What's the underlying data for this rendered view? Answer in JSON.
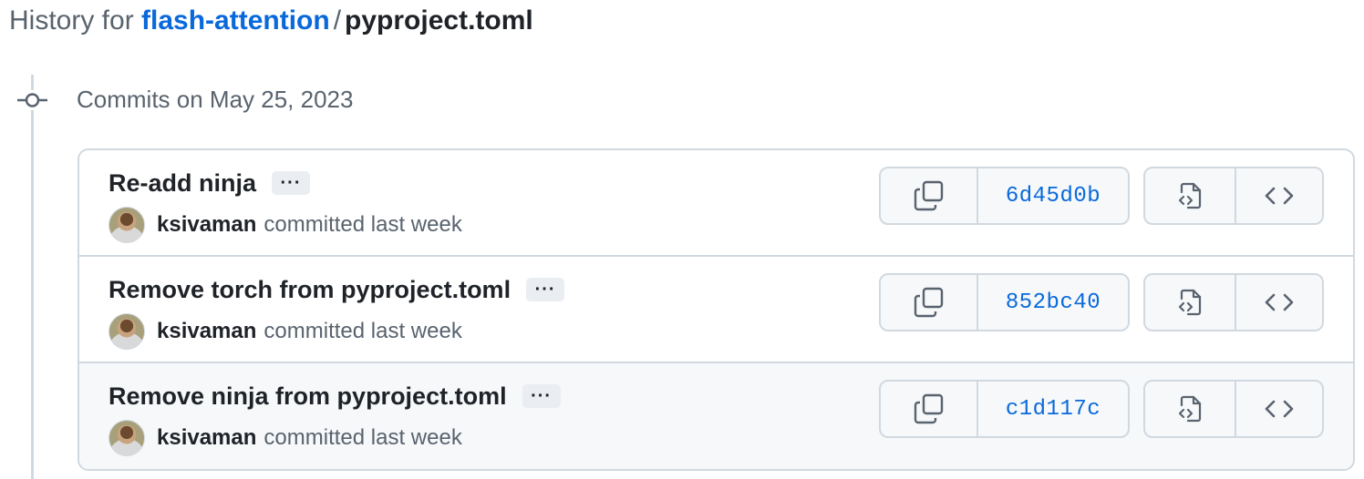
{
  "page": {
    "title_prefix": "History for",
    "repo": "flash-attention",
    "separator": "/",
    "file": "pyproject.toml"
  },
  "timeline": {
    "date_heading": "Commits on May 25, 2023"
  },
  "commits": [
    {
      "message": "Re-add ninja",
      "author": "ksivaman",
      "committed_text": "committed last week",
      "sha": "6d45d0b",
      "ellipsis": "···"
    },
    {
      "message": "Remove torch from pyproject.toml",
      "author": "ksivaman",
      "committed_text": "committed last week",
      "sha": "852bc40",
      "ellipsis": "···"
    },
    {
      "message": "Remove ninja from pyproject.toml",
      "author": "ksivaman",
      "committed_text": "committed last week",
      "sha": "c1d117c",
      "ellipsis": "···"
    }
  ],
  "icons": {
    "commit": "git-commit-icon",
    "copy": "copy-icon",
    "browse_files": "file-code-icon",
    "browse_code": "code-icon"
  },
  "colors": {
    "link": "#0969da",
    "muted": "#59636e",
    "border": "#d1d9e0",
    "hover_row": "#f6f8fa"
  }
}
